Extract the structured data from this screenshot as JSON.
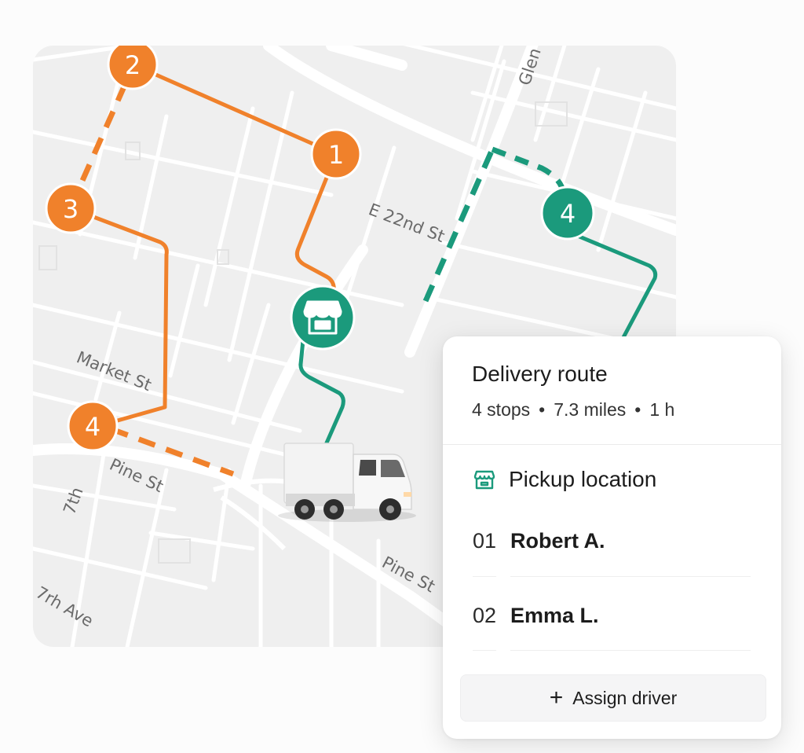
{
  "map": {
    "streets": [
      "Glen",
      "E 22nd St",
      "Market St",
      "Pine St",
      "Pine St",
      "7th",
      "7rh Ave"
    ],
    "route_colors": {
      "orange": "#f0812b",
      "green": "#1b9a7c"
    },
    "stops": [
      {
        "label": "2",
        "route": "orange"
      },
      {
        "label": "1",
        "route": "orange"
      },
      {
        "label": "3",
        "route": "orange"
      },
      {
        "label": "4",
        "route": "orange"
      },
      {
        "label": "4",
        "route": "green"
      }
    ],
    "pickup_pin_icon": "storefront-icon",
    "vehicle_icon": "delivery-truck-icon"
  },
  "panel": {
    "title": "Delivery route",
    "stops_text": "4 stops",
    "distance_text": "7.3 miles",
    "duration_text": "1 h",
    "separator": "•",
    "pickup_label": "Pickup location",
    "pickup_icon": "storefront-icon",
    "stops": [
      {
        "number": "01",
        "name": "Robert A."
      },
      {
        "number": "02",
        "name": "Emma L."
      }
    ],
    "assign_button": {
      "icon": "+",
      "label": "Assign driver"
    }
  }
}
